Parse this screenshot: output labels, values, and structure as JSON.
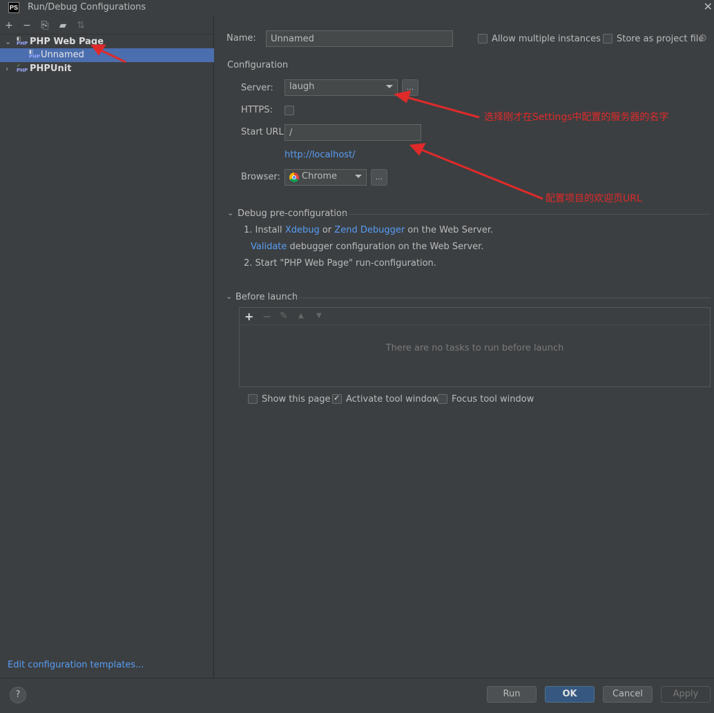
{
  "window": {
    "title": "Run/Debug Configurations",
    "app_icon": "PS",
    "close_glyph": "✕"
  },
  "toolbar": {
    "icons": [
      "add-icon",
      "remove-icon",
      "copy-icon",
      "folder-icon",
      "sort-icon"
    ],
    "add": "+",
    "remove": "−",
    "copy": "⎘",
    "folder": "▰",
    "sort": "⇅"
  },
  "tree": {
    "items": [
      {
        "label": "PHP Web Page",
        "icon_text": "PHP",
        "expanded": true
      },
      {
        "label": "Unnamed",
        "icon_text": "PHP",
        "selected": true
      },
      {
        "label": "PHPUnit",
        "icon_text": "PHP",
        "expanded": false
      }
    ]
  },
  "edit_templates": "Edit configuration templates...",
  "form": {
    "name_label": "Name:",
    "name_value": "Unnamed",
    "allow_multiple": "Allow multiple instances",
    "store_as_project": "Store as project file",
    "configuration_title": "Configuration",
    "server_label": "Server:",
    "server_value": "laugh",
    "https_label": "HTTPS:",
    "start_url_label": "Start URL:",
    "start_url_value": "/",
    "url_preview": "http://localhost/",
    "browser_label": "Browser:",
    "browser_value": "Chrome",
    "dots": "..."
  },
  "debug_pre": {
    "title": "Debug pre-configuration",
    "step1_prefix": "1. Install ",
    "xdebug": "Xdebug",
    "or": " or ",
    "zend": "Zend Debugger",
    "step1_suffix": " on the Web Server.",
    "validate": "Validate",
    "validate_suffix": " debugger configuration on the Web Server.",
    "step2": "2. Start \"PHP Web Page\" run-configuration."
  },
  "before_launch": {
    "title": "Before launch",
    "empty_text": "There are no tasks to run before launch",
    "toolbar": {
      "add": "+",
      "remove": "−",
      "edit": "✎",
      "up": "▲",
      "down": "▼"
    }
  },
  "options": {
    "show_page": "Show this page",
    "activate_tool": "Activate tool window",
    "focus_tool": "Focus tool window"
  },
  "annotations": {
    "server_note": "选择刚才在Settings中配置的服务器的名字",
    "url_note": "配置项目的欢迎页URL",
    "color": "#e02a2a"
  },
  "buttons": {
    "help": "?",
    "run": "Run",
    "ok": "OK",
    "cancel": "Cancel",
    "apply": "Apply"
  }
}
